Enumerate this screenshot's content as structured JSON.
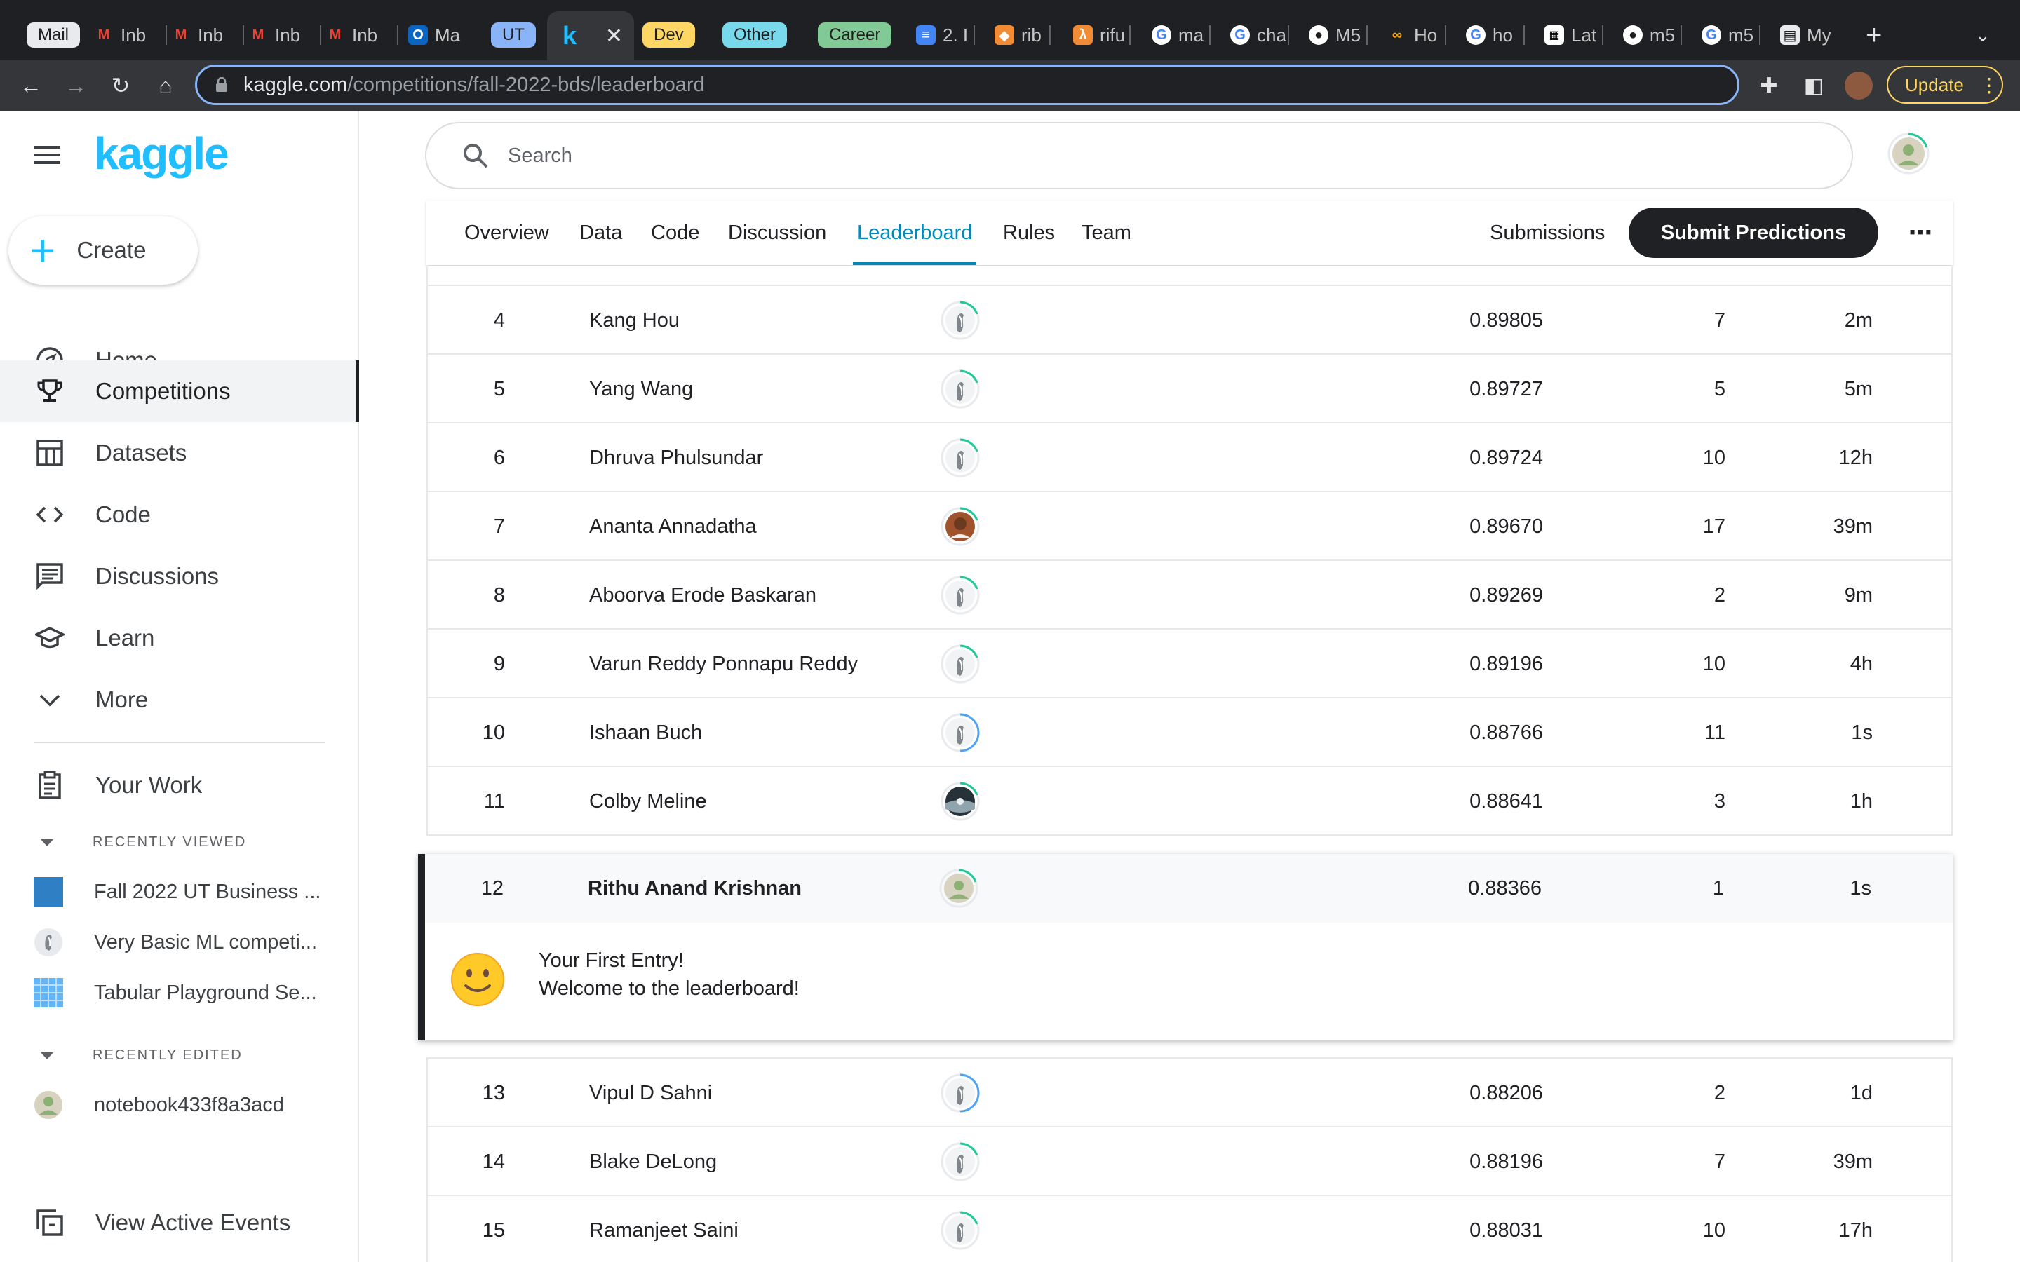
{
  "browser": {
    "tabs": [
      {
        "label": "Mail",
        "kind": "pill",
        "color": "#e8eaed"
      },
      {
        "label": "Inb",
        "icon": "gmail-icon"
      },
      {
        "label": "Inb",
        "icon": "gmail-icon"
      },
      {
        "label": "Inb",
        "icon": "gmail-icon"
      },
      {
        "label": "Inb",
        "icon": "gmail-icon"
      },
      {
        "label": "Ma",
        "icon": "outlook-icon"
      },
      {
        "label": "UT",
        "kind": "pill",
        "color": "#8ab4f8"
      },
      {
        "label": "Dev",
        "kind": "pill",
        "color": "#fdd663"
      },
      {
        "label": "Other",
        "kind": "pill",
        "color": "#78d9ec"
      },
      {
        "label": "Career",
        "kind": "pill",
        "color": "#81c995"
      },
      {
        "label": "2. I",
        "icon": "docs-icon"
      },
      {
        "label": "rib",
        "icon": "box-icon"
      },
      {
        "label": "rifu",
        "icon": "lambda-icon"
      },
      {
        "label": "ma",
        "icon": "google-icon"
      },
      {
        "label": "cha",
        "icon": "google-icon"
      },
      {
        "label": "M5",
        "icon": "github-icon"
      },
      {
        "label": "Ho",
        "icon": "colab-icon"
      },
      {
        "label": "ho",
        "icon": "google-icon"
      },
      {
        "label": "Lat",
        "icon": "qr-icon"
      },
      {
        "label": "m5",
        "icon": "github-icon"
      },
      {
        "label": "m5",
        "icon": "google-icon"
      },
      {
        "label": "My",
        "icon": "book-icon"
      }
    ],
    "active_tab_letter": "k",
    "url_host": "kaggle.com",
    "url_path": "/competitions/fall-2022-bds/leaderboard",
    "update_label": "Update"
  },
  "sidebar": {
    "logo": "kaggle",
    "create_label": "Create",
    "nav": [
      {
        "label": "Home",
        "icon": "compass-icon"
      },
      {
        "label": "Competitions",
        "icon": "trophy-icon",
        "active": true
      },
      {
        "label": "Datasets",
        "icon": "table-icon"
      },
      {
        "label": "Code",
        "icon": "code-icon"
      },
      {
        "label": "Discussions",
        "icon": "chat-icon"
      },
      {
        "label": "Learn",
        "icon": "graduation-cap-icon"
      },
      {
        "label": "More",
        "icon": "chevron-down-icon"
      }
    ],
    "your_work": "Your Work",
    "recently_viewed_header": "RECENTLY VIEWED",
    "recently_viewed": [
      "Fall 2022 UT Business ...",
      "Very Basic ML competi...",
      "Tabular Playground Se..."
    ],
    "recently_edited_header": "RECENTLY EDITED",
    "recently_edited": [
      "notebook433f8a3acd"
    ],
    "view_events": "View Active Events"
  },
  "search": {
    "placeholder": "Search"
  },
  "competition_tabs": {
    "items": [
      "Overview",
      "Data",
      "Code",
      "Discussion",
      "Leaderboard",
      "Rules",
      "Team"
    ],
    "active": "Leaderboard",
    "submissions": "Submissions",
    "submit": "Submit Predictions"
  },
  "leaderboard": {
    "rows_before": [
      {
        "rank": "4",
        "name": "Kang Hou",
        "score": "0.89805",
        "entries": "7",
        "last": "2m",
        "avatar": "default"
      },
      {
        "rank": "5",
        "name": "Yang Wang",
        "score": "0.89727",
        "entries": "5",
        "last": "5m",
        "avatar": "default"
      },
      {
        "rank": "6",
        "name": "Dhruva Phulsundar",
        "score": "0.89724",
        "entries": "10",
        "last": "12h",
        "avatar": "default"
      },
      {
        "rank": "7",
        "name": "Ananta Annadatha",
        "score": "0.89670",
        "entries": "17",
        "last": "39m",
        "avatar": "photo"
      },
      {
        "rank": "8",
        "name": "Aboorva Erode Baskaran",
        "score": "0.89269",
        "entries": "2",
        "last": "9m",
        "avatar": "default"
      },
      {
        "rank": "9",
        "name": "Varun Reddy Ponnapu Reddy",
        "score": "0.89196",
        "entries": "10",
        "last": "4h",
        "avatar": "default"
      },
      {
        "rank": "10",
        "name": "Ishaan Buch",
        "score": "0.88766",
        "entries": "11",
        "last": "1s",
        "avatar": "default-blue"
      },
      {
        "rank": "11",
        "name": "Colby Meline",
        "score": "0.88641",
        "entries": "3",
        "last": "1h",
        "avatar": "dark"
      }
    ],
    "my_entry": {
      "rank": "12",
      "name": "Rithu Anand Krishnan",
      "score": "0.88366",
      "entries": "1",
      "last": "1s"
    },
    "my_message_line1": "Your First Entry!",
    "my_message_line2": "Welcome to the leaderboard!",
    "rows_after": [
      {
        "rank": "13",
        "name": "Vipul D Sahni",
        "score": "0.88206",
        "entries": "2",
        "last": "1d",
        "avatar": "default-blue"
      },
      {
        "rank": "14",
        "name": "Blake DeLong",
        "score": "0.88196",
        "entries": "7",
        "last": "39m",
        "avatar": "default"
      },
      {
        "rank": "15",
        "name": "Ramanjeet Saini",
        "score": "0.88031",
        "entries": "10",
        "last": "17h",
        "avatar": "default"
      }
    ]
  }
}
